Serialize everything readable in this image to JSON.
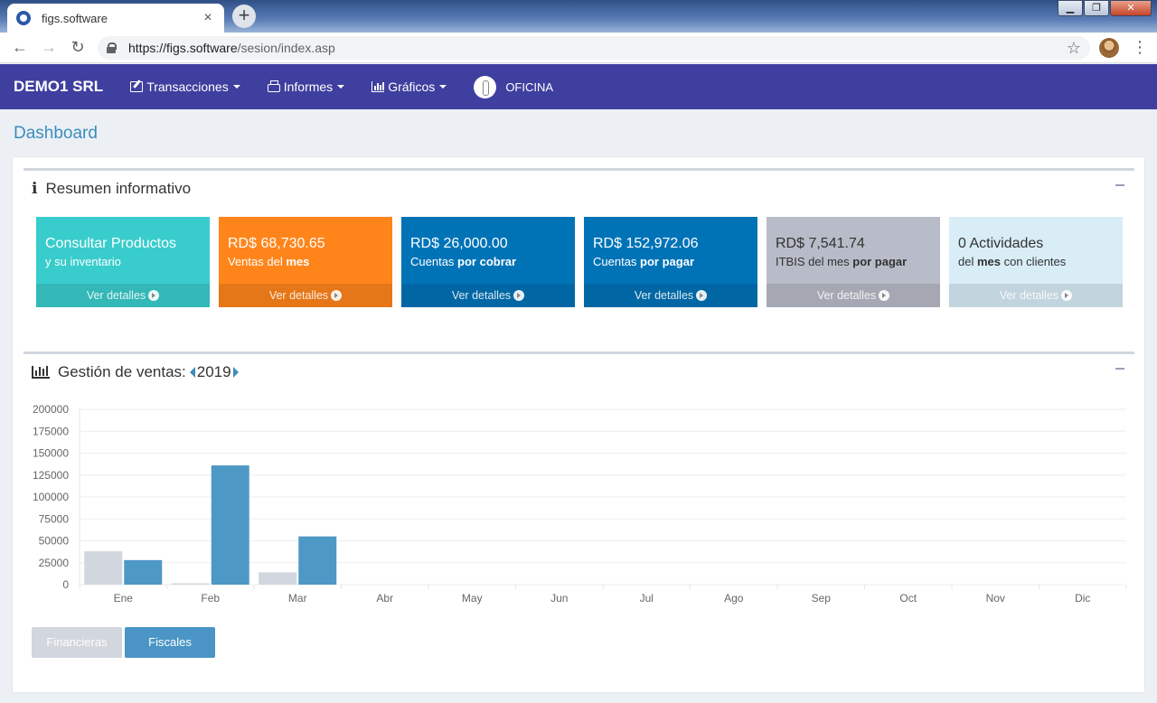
{
  "browser": {
    "tab_title": "figs.software",
    "tab_close": "×",
    "new_tab": "+",
    "url_host": "https://figs.software",
    "url_path": "/sesion/index.asp",
    "back": "←",
    "forward": "→",
    "reload": "↻",
    "star": "☆",
    "menu": "⋮",
    "window_minimize": "▁",
    "window_maximize": "❐",
    "window_close": "✕"
  },
  "navbar": {
    "brand": "DEMO1 SRL",
    "items": [
      {
        "label": "Transacciones",
        "icon": "edit-icon"
      },
      {
        "label": "Informes",
        "icon": "print-icon"
      },
      {
        "label": "Gráficos",
        "icon": "bar-chart-icon"
      }
    ],
    "office": "OFICINA"
  },
  "page": {
    "title": "Dashboard"
  },
  "summary": {
    "title": "Resumen informativo",
    "tiles": [
      {
        "main": "Consultar Productos",
        "sub_pre": "y su inventario",
        "sub_bold": "",
        "sub_mid": "",
        "sub_bold2": "",
        "footer": "Ver detalles",
        "color": "#39cccc"
      },
      {
        "main": "RD$ 68,730.65",
        "sub_pre": "Ventas del ",
        "sub_bold": "mes",
        "sub_mid": "",
        "sub_bold2": "",
        "footer": "Ver detalles",
        "color": "#ff851b"
      },
      {
        "main": "RD$ 26,000.00",
        "sub_pre": "Cuentas ",
        "sub_bold": "por cobrar",
        "sub_mid": "",
        "sub_bold2": "",
        "footer": "Ver detalles",
        "color": "#0073b7"
      },
      {
        "main": "RD$ 152,972.06",
        "sub_pre": "Cuentas ",
        "sub_bold": "por pagar",
        "sub_mid": "",
        "sub_bold2": "",
        "footer": "Ver detalles",
        "color": "#0073b7"
      },
      {
        "main": "RD$ 7,541.74",
        "sub_pre": "ITBIS del mes ",
        "sub_bold": "por pagar",
        "sub_mid": "",
        "sub_bold2": "",
        "footer": "Ver detalles",
        "color": "#b8bcc8"
      },
      {
        "main": "0 Actividades",
        "sub_pre": "del ",
        "sub_bold": "mes",
        "sub_mid": " con clientes",
        "sub_bold2": "",
        "footer": "Ver detalles",
        "color": "#d9edf7"
      }
    ]
  },
  "sales": {
    "title": "Gestión de ventas:",
    "year": "2019",
    "buttons": [
      {
        "label": "Financieras",
        "color": "#d2d6de"
      },
      {
        "label": "Fiscales",
        "color": "#4a95c5"
      }
    ]
  },
  "chart_data": {
    "type": "bar",
    "categories": [
      "Ene",
      "Feb",
      "Mar",
      "Abr",
      "May",
      "Jun",
      "Jul",
      "Ago",
      "Sep",
      "Oct",
      "Nov",
      "Dic"
    ],
    "series": [
      {
        "values": [
          38000,
          1500,
          14000,
          0,
          0,
          0,
          0,
          0,
          0,
          0,
          0,
          0
        ],
        "color": "#d2d6de"
      },
      {
        "values": [
          28000,
          136000,
          55000,
          0,
          0,
          0,
          0,
          0,
          0,
          0,
          0,
          0
        ],
        "color": "#4e98c6"
      }
    ],
    "yticks": [
      0,
      25000,
      50000,
      75000,
      100000,
      125000,
      150000,
      175000,
      200000
    ],
    "ylim": [
      0,
      200000
    ],
    "grid": true
  }
}
